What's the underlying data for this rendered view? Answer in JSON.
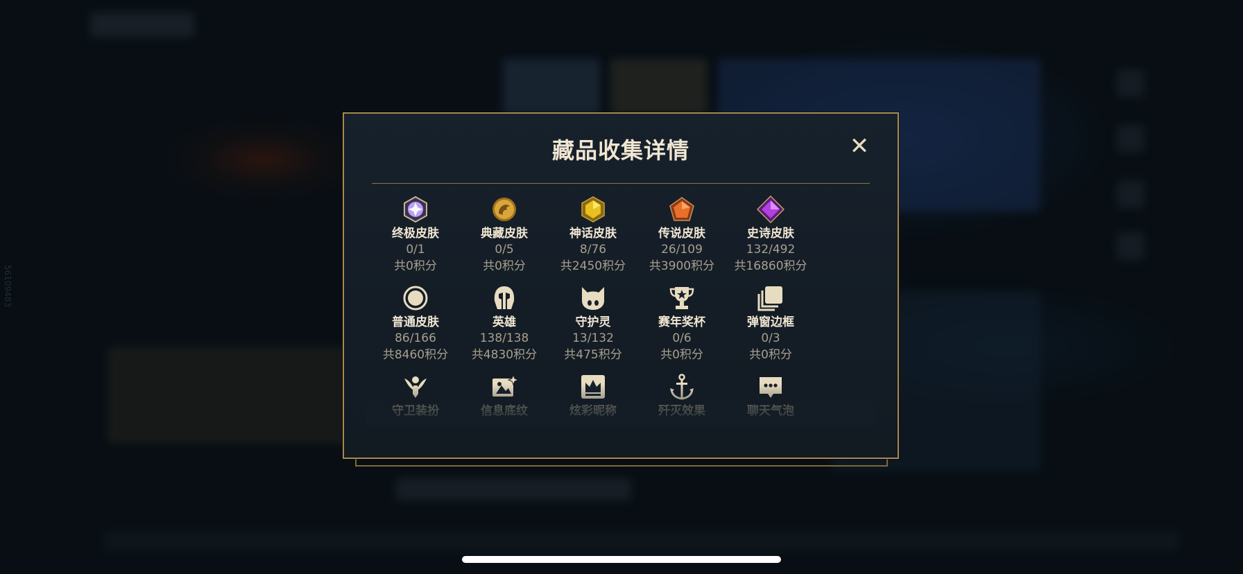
{
  "modal": {
    "title": "藏品收集详情",
    "close_label": "✕"
  },
  "background": {
    "id_text": "56109483"
  },
  "items": [
    {
      "name": "终极皮肤",
      "count": "0/1",
      "points": "共0积分",
      "icon": "ultimate-skin-icon",
      "color": "#b9a0f0"
    },
    {
      "name": "典藏皮肤",
      "count": "0/5",
      "points": "共0积分",
      "icon": "prestige-skin-icon",
      "color": "#d8a63a"
    },
    {
      "name": "神话皮肤",
      "count": "8/76",
      "points": "共2450积分",
      "icon": "mythic-skin-icon",
      "color": "#e8c020"
    },
    {
      "name": "传说皮肤",
      "count": "26/109",
      "points": "共3900积分",
      "icon": "legendary-skin-icon",
      "color": "#e8702a"
    },
    {
      "name": "史诗皮肤",
      "count": "132/492",
      "points": "共16860积分",
      "icon": "epic-skin-icon",
      "color": "#b040e0"
    },
    {
      "name": "普通皮肤",
      "count": "86/166",
      "points": "共8460积分",
      "icon": "standard-skin-icon",
      "color": "#e8dcc0"
    },
    {
      "name": "英雄",
      "count": "138/138",
      "points": "共4830积分",
      "icon": "champion-helmet-icon",
      "color": "#e8dcc0"
    },
    {
      "name": "守护灵",
      "count": "13/132",
      "points": "共475积分",
      "icon": "little-legend-icon",
      "color": "#e8dcc0"
    },
    {
      "name": "赛年奖杯",
      "count": "0/6",
      "points": "共0积分",
      "icon": "trophy-icon",
      "color": "#e8dcc0"
    },
    {
      "name": "弹窗边框",
      "count": "0/3",
      "points": "共0积分",
      "icon": "popup-frame-icon",
      "color": "#e8dcc0"
    },
    {
      "name": "守卫装扮",
      "icon": "ward-skin-icon",
      "color": "#e8dcc0"
    },
    {
      "name": "信息底纹",
      "icon": "banner-icon",
      "color": "#e8dcc0"
    },
    {
      "name": "炫彩昵称",
      "icon": "nickname-crown-icon",
      "color": "#e8dcc0"
    },
    {
      "name": "歼灭效果",
      "icon": "finisher-anchor-icon",
      "color": "#e8dcc0"
    },
    {
      "name": "聊天气泡",
      "icon": "chat-bubble-icon",
      "color": "#e8dcc0"
    }
  ]
}
